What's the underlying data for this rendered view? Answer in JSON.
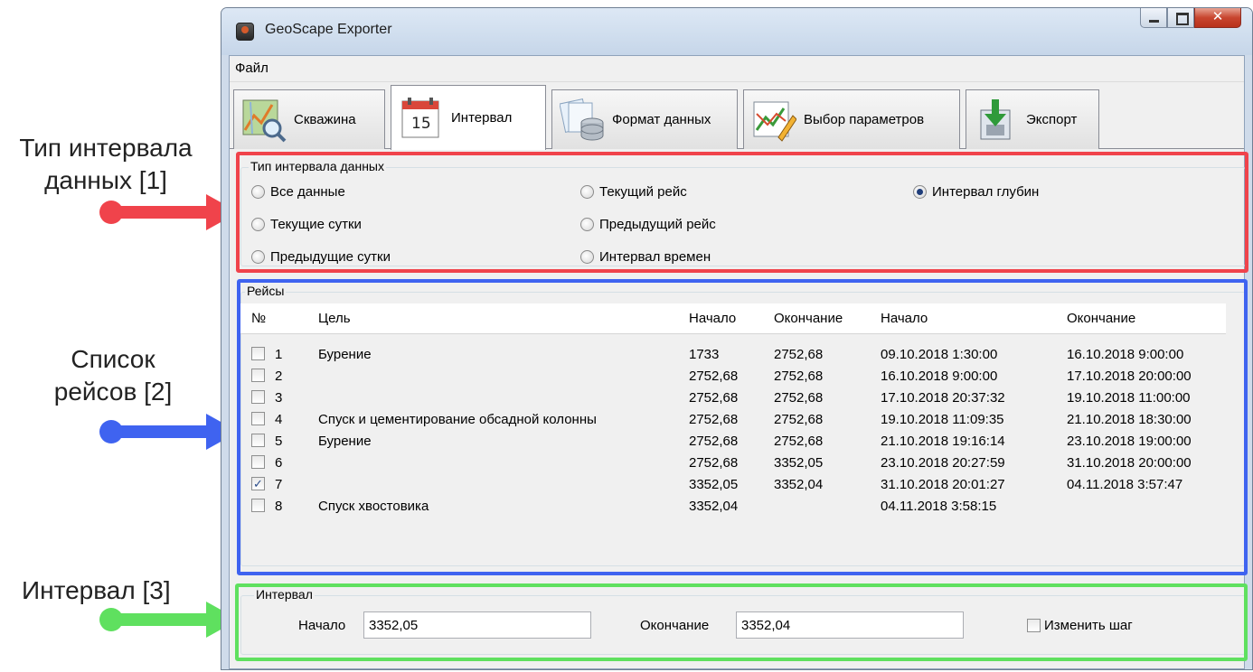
{
  "window": {
    "title": "GeoScape Exporter"
  },
  "menu": {
    "items": [
      "Файл"
    ]
  },
  "tabs": [
    {
      "label": "Скважина",
      "icon": "well-map-icon"
    },
    {
      "label": "Интервал",
      "icon": "calendar-icon",
      "icon_text": "15"
    },
    {
      "label": "Формат данных",
      "icon": "database-icon"
    },
    {
      "label": "Выбор параметров",
      "icon": "chart-edit-icon"
    },
    {
      "label": "Экспорт",
      "icon": "export-icon"
    }
  ],
  "active_tab": "Интервал",
  "interval_type": {
    "title": "Тип интервала данных",
    "options": [
      {
        "label": "Все данные",
        "selected": false
      },
      {
        "label": "Текущие сутки",
        "selected": false
      },
      {
        "label": "Предыдущие сутки",
        "selected": false
      },
      {
        "label": "Текущий рейс",
        "selected": false
      },
      {
        "label": "Предыдущий рейс",
        "selected": false
      },
      {
        "label": "Интервал времен",
        "selected": false
      },
      {
        "label": "Интервал глубин",
        "selected": true
      }
    ]
  },
  "runs": {
    "title": "Рейсы",
    "columns": [
      "№",
      "Цель",
      "Начало",
      "Окончание",
      "Начало",
      "Окончание"
    ],
    "rows": [
      {
        "checked": false,
        "num": "1",
        "goal": "Бурение",
        "start_depth": "1733",
        "end_depth": "2752,68",
        "start_time": "09.10.2018 1:30:00",
        "end_time": "16.10.2018 9:00:00"
      },
      {
        "checked": false,
        "num": "2",
        "goal": "",
        "start_depth": "2752,68",
        "end_depth": "2752,68",
        "start_time": "16.10.2018 9:00:00",
        "end_time": "17.10.2018 20:00:00"
      },
      {
        "checked": false,
        "num": "3",
        "goal": "",
        "start_depth": "2752,68",
        "end_depth": "2752,68",
        "start_time": "17.10.2018 20:37:32",
        "end_time": "19.10.2018 11:00:00"
      },
      {
        "checked": false,
        "num": "4",
        "goal": "Спуск и цементирование обсадной колонны",
        "start_depth": "2752,68",
        "end_depth": "2752,68",
        "start_time": "19.10.2018 11:09:35",
        "end_time": "21.10.2018 18:30:00"
      },
      {
        "checked": false,
        "num": "5",
        "goal": "Бурение",
        "start_depth": "2752,68",
        "end_depth": "2752,68",
        "start_time": "21.10.2018 19:16:14",
        "end_time": "23.10.2018 19:00:00"
      },
      {
        "checked": false,
        "num": "6",
        "goal": "",
        "start_depth": "2752,68",
        "end_depth": "3352,05",
        "start_time": "23.10.2018 20:27:59",
        "end_time": "31.10.2018 20:00:00"
      },
      {
        "checked": true,
        "num": "7",
        "goal": "",
        "start_depth": "3352,05",
        "end_depth": "3352,04",
        "start_time": "31.10.2018 20:01:27",
        "end_time": "04.11.2018 3:57:47"
      },
      {
        "checked": false,
        "num": "8",
        "goal": "Спуск хвостовика",
        "start_depth": "3352,04",
        "end_depth": "",
        "start_time": "04.11.2018 3:58:15",
        "end_time": ""
      }
    ]
  },
  "interval": {
    "title": "Интервал",
    "start_label": "Начало",
    "start_value": "3352,05",
    "end_label": "Окончание",
    "end_value": "3352,04",
    "change_step_label": "Изменить шаг",
    "change_step_checked": false
  },
  "callouts": [
    {
      "text": "Тип интервала данных [1]",
      "color": "#f0434b"
    },
    {
      "text": "Список рейсов [2]",
      "color": "#3f63f0"
    },
    {
      "text": "Интервал [3]",
      "color": "#5fe05f"
    }
  ],
  "colors": {
    "highlight_red": "#f0434b",
    "highlight_blue": "#3f63f0",
    "highlight_green": "#5fe05f",
    "title_bar": "#c6d6e9",
    "close_button": "#c8452f"
  }
}
